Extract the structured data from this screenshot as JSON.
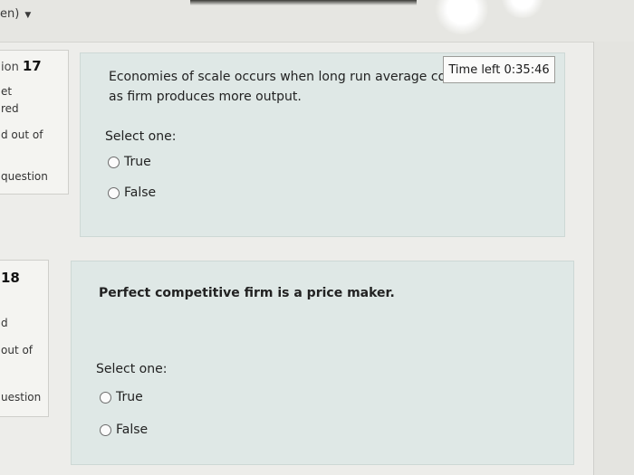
{
  "header": {
    "language": "en)",
    "caret_icon": "caret-down-icon"
  },
  "timer": {
    "label": "Time left 0:35:46"
  },
  "questions": [
    {
      "info": {
        "number_prefix": "ion",
        "number": "17",
        "status": "et",
        "status2": "red",
        "marks": "d out of",
        "flag": "question"
      },
      "text_line1": "Economies of scale occurs when long run average co",
      "text_line2": "as firm produces more output.",
      "select_label": "Select one:",
      "options": [
        "True",
        "False"
      ]
    },
    {
      "info": {
        "number_prefix": "",
        "number": "18",
        "status": "d",
        "marks": "out of",
        "flag": "uestion"
      },
      "text_line1": "Perfect competitive firm  is a price maker.",
      "select_label": "Select one:",
      "options": [
        "True",
        "False"
      ]
    }
  ]
}
